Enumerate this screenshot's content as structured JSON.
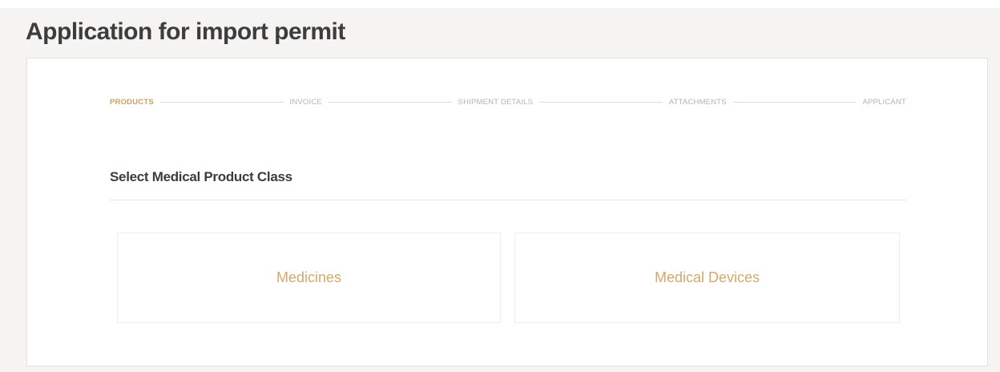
{
  "page": {
    "title": "Application for import permit"
  },
  "stepper": {
    "steps": [
      {
        "label": "PRODUCTS",
        "active": true
      },
      {
        "label": "INVOICE",
        "active": false
      },
      {
        "label": "SHIPMENT DETAILS",
        "active": false
      },
      {
        "label": "ATTACHMENTS",
        "active": false
      },
      {
        "label": "APPLICANT",
        "active": false
      }
    ]
  },
  "section": {
    "title": "Select Medical Product Class"
  },
  "options": [
    {
      "label": "Medicines"
    },
    {
      "label": "Medical Devices"
    }
  ],
  "colors": {
    "accent": "#d4a86a",
    "active_step": "#c9a062",
    "inactive_step": "#b3b3b3",
    "title_text": "#3d3d3d",
    "background": "#f5f4f2"
  }
}
